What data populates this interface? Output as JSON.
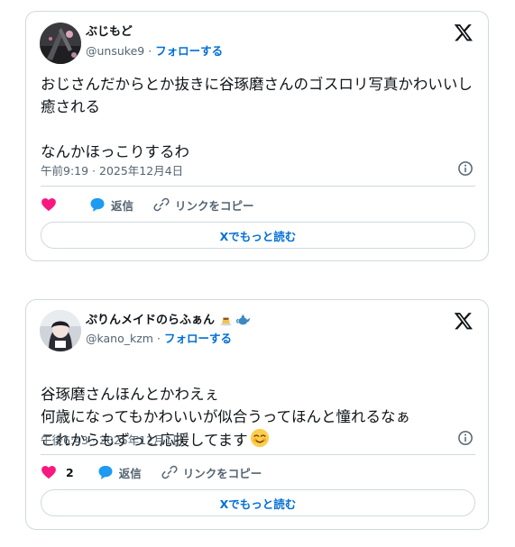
{
  "colors": {
    "accent": "#006fd6",
    "like": "#f91880",
    "reply": "#1d9bf0",
    "muted": "#536471",
    "border": "#cfd9de"
  },
  "tweets": [
    {
      "display_name": "ぶじもど",
      "handle": "@unsuke9",
      "separator": "·",
      "follow_label": "フォローする",
      "text": "おじさんだからとか抜きに谷琢磨さんのゴスロリ写真かわいいし癒される\n\nなんかほっこりするわ",
      "timestamp": "午前9:19 · 2025年12月4日",
      "like_count": "",
      "reply_label": "返信",
      "copy_link_label": "リンクをコピー",
      "read_more_label": "Xでもっと読む",
      "icons": [
        "x-logo-icon",
        "info-icon",
        "heart-icon",
        "reply-bubble-icon",
        "link-icon"
      ]
    },
    {
      "display_name": "ぷりんメイドのらふぁん",
      "name_emojis": [
        "pudding-emoji-icon",
        "teapot-emoji-icon"
      ],
      "handle": "@kano_kzm",
      "separator": "·",
      "follow_label": "フォローする",
      "text": "谷琢磨さんほんとかわえぇ\n何歳になってもかわいいが似合うってほんと憧れるなぁ\nこれからもずっと応援してます",
      "text_end_emoji": "smiling-face-icon",
      "timestamp": "午後6:43 · 2025年12月1日",
      "like_count": "2",
      "reply_label": "返信",
      "copy_link_label": "リンクをコピー",
      "read_more_label": "Xでもっと読む",
      "icons": [
        "x-logo-icon",
        "info-icon",
        "heart-icon",
        "reply-bubble-icon",
        "link-icon"
      ]
    }
  ]
}
